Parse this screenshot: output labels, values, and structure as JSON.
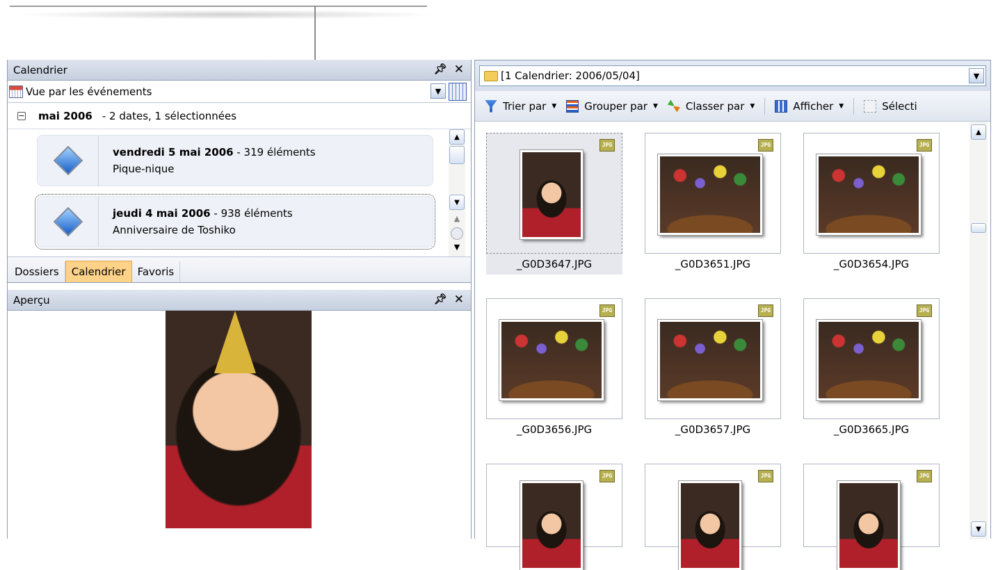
{
  "calendar_panel": {
    "title": "Calendrier",
    "view_mode": "Vue par les événements",
    "month": {
      "label": "mai 2006",
      "summary": "- 2 dates, 1 sélectionnées"
    },
    "events": [
      {
        "date": "vendredi 5 mai 2006",
        "count": "- 319 éléments",
        "name": "Pique-nique",
        "selected": false
      },
      {
        "date": "jeudi 4 mai 2006",
        "count": "- 938 éléments",
        "name": "Anniversaire de Toshiko",
        "selected": true
      }
    ]
  },
  "nav_tabs": [
    {
      "label": "Dossiers",
      "active": false
    },
    {
      "label": "Calendrier",
      "active": true
    },
    {
      "label": "Favoris",
      "active": false
    }
  ],
  "preview_panel": {
    "title": "Aperçu"
  },
  "browser": {
    "address": "[1 Calendrier: 2006/05/04]",
    "toolbar": {
      "sort": "Trier par",
      "group": "Grouper par",
      "order": "Classer par",
      "view": "Afficher",
      "select": "Sélecti"
    },
    "thumbnails": [
      {
        "name": "_G0D3647.JPG",
        "badge": "JPG",
        "orientation": "portrait",
        "selected": true
      },
      {
        "name": "_G0D3651.JPG",
        "badge": "JPG",
        "orientation": "landscape",
        "selected": false
      },
      {
        "name": "_G0D3654.JPG",
        "badge": "JPG",
        "orientation": "landscape",
        "selected": false
      },
      {
        "name": "_G0D3656.JPG",
        "badge": "JPG",
        "orientation": "landscape",
        "selected": false
      },
      {
        "name": "_G0D3657.JPG",
        "badge": "JPG",
        "orientation": "landscape",
        "selected": false
      },
      {
        "name": "_G0D3665.JPG",
        "badge": "JPG",
        "orientation": "landscape",
        "selected": false
      },
      {
        "name": "",
        "badge": "JPG",
        "orientation": "portrait",
        "selected": false
      },
      {
        "name": "",
        "badge": "JPG",
        "orientation": "portrait",
        "selected": false
      },
      {
        "name": "",
        "badge": "JPG",
        "orientation": "portrait",
        "selected": false
      }
    ]
  },
  "colors": {
    "selection": "#e6e8ed",
    "active_tab": "#ffd28a",
    "panel_header": "#c6cfdf"
  }
}
